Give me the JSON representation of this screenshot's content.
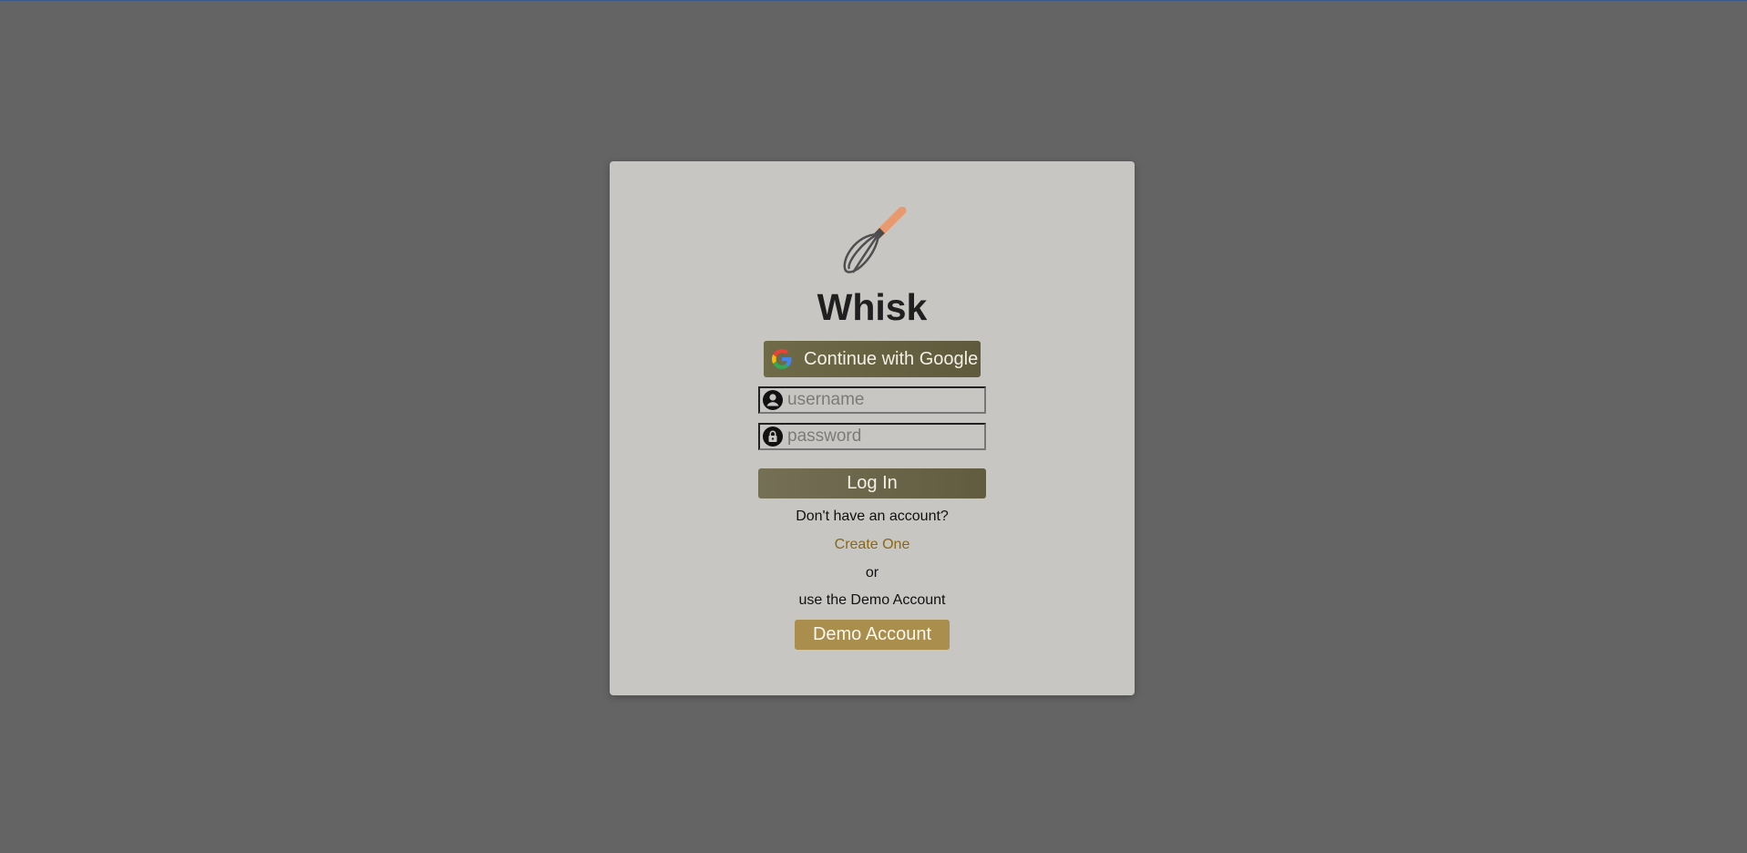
{
  "app": {
    "title": "Whisk",
    "logo_icon": "whisk-icon"
  },
  "auth": {
    "google_button_label": "Continue with Google",
    "google_icon": "google-icon",
    "username_placeholder": "username",
    "username_icon": "user-icon",
    "password_placeholder": "password",
    "password_icon": "lock-icon",
    "login_button_label": "Log In",
    "no_account_text": "Don't have an account?",
    "create_link_label": "Create One",
    "or_text": "or",
    "demo_text": "use the Demo Account",
    "demo_button_label": "Demo Account"
  },
  "colors": {
    "backdrop": "#646464",
    "modal_bg": "#c8c6c2",
    "primary_button": "#6a6547",
    "demo_button": "#a98e4d",
    "link": "#8a6716"
  }
}
